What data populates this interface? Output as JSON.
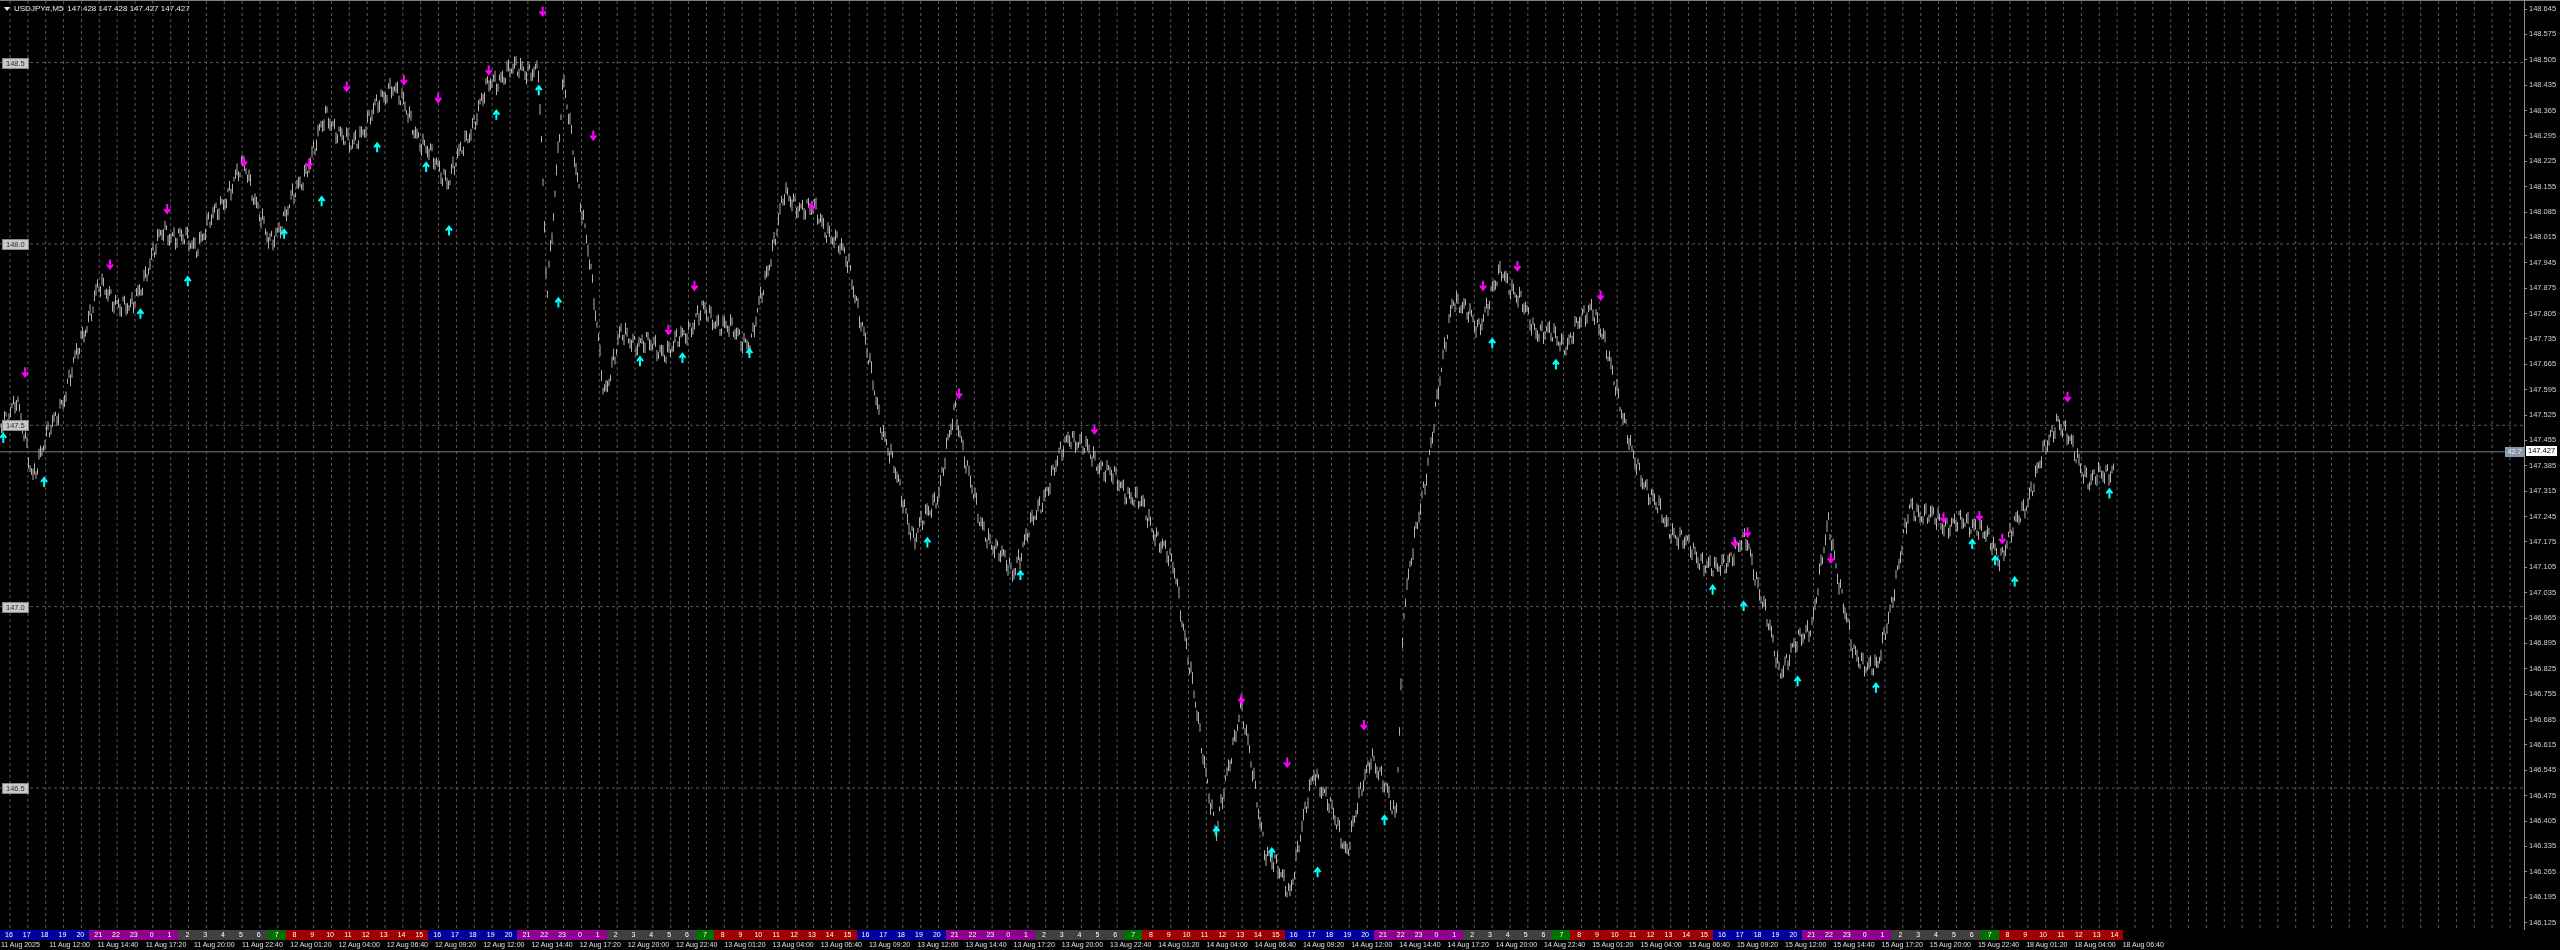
{
  "symbol_header": {
    "symbol": "USDJPY#,M5",
    "prices": [
      "147.428",
      "147.428",
      "147.427",
      "147.427"
    ]
  },
  "level_labels": [
    "148.5",
    "148.0",
    "147.5",
    "147.0",
    "146.5"
  ],
  "current_price_line_label": "42.7",
  "price_axis": {
    "ticks": [
      "148.645",
      "148.575",
      "148.505",
      "148.435",
      "148.365",
      "148.295",
      "148.225",
      "148.155",
      "148.085",
      "148.015",
      "147.945",
      "147.875",
      "147.805",
      "147.735",
      "147.665",
      "147.595",
      "147.525",
      "147.455",
      "147.385",
      "147.315",
      "147.245",
      "147.175",
      "147.105",
      "147.035",
      "146.965",
      "146.895",
      "146.825",
      "146.755",
      "146.685",
      "146.615",
      "146.545",
      "146.475",
      "146.405",
      "146.335",
      "146.265",
      "146.195",
      "146.125"
    ],
    "current_price": "147.427"
  },
  "hour_bar": [
    {
      "color": "#0000a0",
      "hours": [
        "16",
        "17",
        "18",
        "19",
        "20"
      ]
    },
    {
      "color": "#900090",
      "hours": [
        "21",
        "22",
        "23",
        "0",
        "1"
      ]
    },
    {
      "color": "#404040",
      "hours": [
        "2",
        "3",
        "4",
        "5",
        "6"
      ]
    },
    {
      "color": "#007000",
      "hours": [
        "7"
      ]
    },
    {
      "color": "#a00000",
      "hours": [
        "8",
        "9",
        "10",
        "11",
        "12",
        "13",
        "14",
        "15"
      ]
    },
    {
      "color": "#0000a0",
      "hours": [
        "16",
        "17",
        "18",
        "19",
        "20"
      ]
    },
    {
      "color": "#900090",
      "hours": [
        "21",
        "22",
        "23",
        "0",
        "1"
      ]
    },
    {
      "color": "#404040",
      "hours": [
        "2",
        "3",
        "4",
        "5",
        "6"
      ]
    },
    {
      "color": "#007000",
      "hours": [
        "7"
      ]
    },
    {
      "color": "#a00000",
      "hours": [
        "8",
        "9",
        "10",
        "11",
        "12",
        "13",
        "14",
        "15"
      ]
    },
    {
      "color": "#0000a0",
      "hours": [
        "16",
        "17",
        "18",
        "19",
        "20"
      ]
    },
    {
      "color": "#900090",
      "hours": [
        "21",
        "22",
        "23",
        "0",
        "1"
      ]
    },
    {
      "color": "#404040",
      "hours": [
        "2",
        "3",
        "4",
        "5",
        "6"
      ]
    },
    {
      "color": "#007000",
      "hours": [
        "7"
      ]
    },
    {
      "color": "#a00000",
      "hours": [
        "8",
        "9",
        "10",
        "11",
        "12",
        "13",
        "14",
        "15"
      ]
    },
    {
      "color": "#0000a0",
      "hours": [
        "16",
        "17",
        "18",
        "19",
        "20"
      ]
    },
    {
      "color": "#900090",
      "hours": [
        "21",
        "22",
        "23",
        "0",
        "1"
      ]
    },
    {
      "color": "#404040",
      "hours": [
        "2",
        "3",
        "4",
        "5",
        "6"
      ]
    },
    {
      "color": "#007000",
      "hours": [
        "7"
      ]
    },
    {
      "color": "#a00000",
      "hours": [
        "8",
        "9",
        "10",
        "11",
        "12",
        "13",
        "14",
        "15"
      ]
    },
    {
      "color": "#0000a0",
      "hours": [
        "16",
        "17",
        "18",
        "19",
        "20"
      ]
    },
    {
      "color": "#900090",
      "hours": [
        "21",
        "22",
        "23",
        "0",
        "1"
      ]
    },
    {
      "color": "#404040",
      "hours": [
        "2",
        "3",
        "4",
        "5",
        "6"
      ]
    },
    {
      "color": "#007000",
      "hours": [
        "7"
      ]
    },
    {
      "color": "#a00000",
      "hours": [
        "8",
        "9",
        "10",
        "11",
        "12",
        "13",
        "14"
      ]
    }
  ],
  "time_axis": [
    "11 Aug 2025",
    "11 Aug 12:00",
    "11 Aug 14:40",
    "11 Aug 17:20",
    "11 Aug 20:00",
    "11 Aug 22:40",
    "12 Aug 01:20",
    "12 Aug 04:00",
    "12 Aug 06:40",
    "12 Aug 09:20",
    "12 Aug 12:00",
    "12 Aug 14:40",
    "12 Aug 17:20",
    "12 Aug 20:00",
    "12 Aug 22:40",
    "13 Aug 01:20",
    "13 Aug 04:00",
    "13 Aug 06:40",
    "13 Aug 09:20",
    "13 Aug 12:00",
    "13 Aug 14:40",
    "13 Aug 17:20",
    "13 Aug 20:00",
    "13 Aug 22:40",
    "14 Aug 01:20",
    "14 Aug 04:00",
    "14 Aug 06:40",
    "14 Aug 09:20",
    "14 Aug 12:00",
    "14 Aug 14:40",
    "14 Aug 17:20",
    "14 Aug 20:00",
    "14 Aug 22:40",
    "15 Aug 01:20",
    "15 Aug 04:00",
    "15 Aug 06:40",
    "15 Aug 09:20",
    "15 Aug 12:00",
    "15 Aug 14:40",
    "15 Aug 17:20",
    "15 Aug 20:00",
    "15 Aug 22:40",
    "18 Aug 01:20",
    "18 Aug 04:00",
    "18 Aug 06:40"
  ]
}
